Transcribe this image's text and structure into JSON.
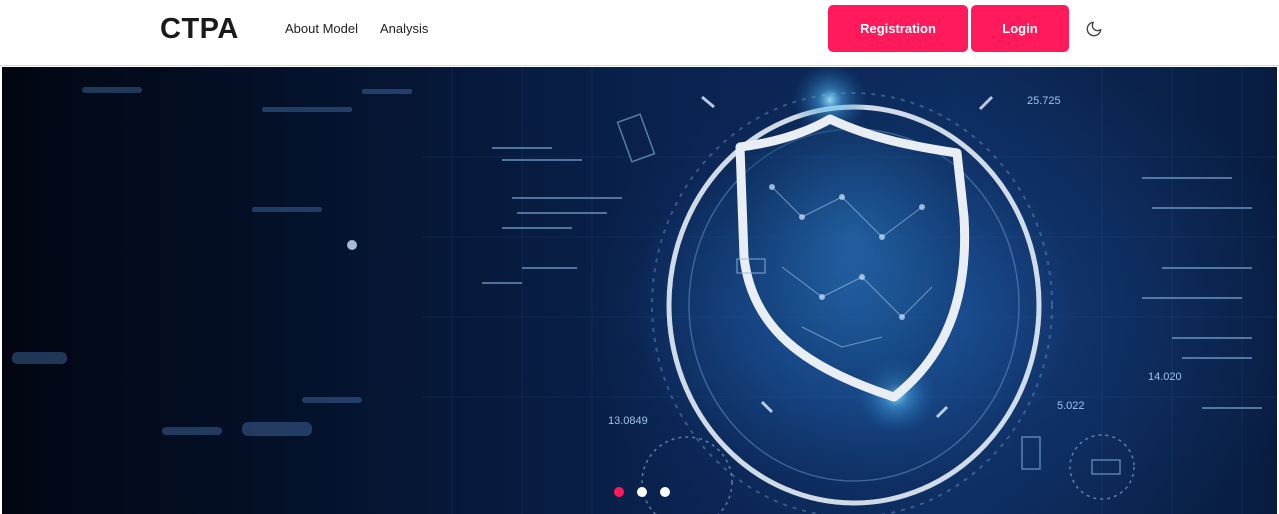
{
  "header": {
    "brand": "CTPA",
    "nav_links": [
      "About Model",
      "Analysis"
    ],
    "registration_label": "Registration",
    "login_label": "Login",
    "theme_icon": "moon-icon"
  },
  "hero": {
    "image": "cyber-security-shield-banner",
    "overlay_numbers": [
      "13.0849",
      "14.020",
      "25.725",
      "5.022"
    ],
    "slides": 3,
    "active_slide": 1
  },
  "colors": {
    "accent": "#ff1a5c",
    "hero_dark": "#04122c",
    "hero_glow": "#2878c8"
  }
}
